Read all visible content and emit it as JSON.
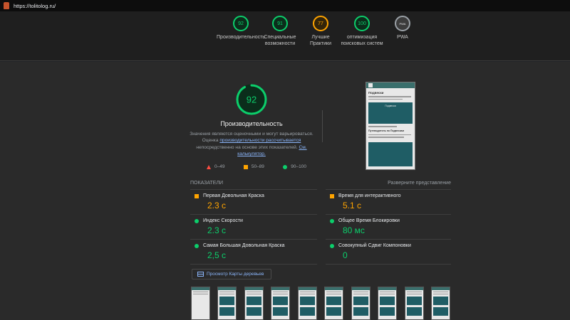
{
  "browser": {
    "url": "https://tolitolog.ru/"
  },
  "categories": [
    {
      "score": "92",
      "label": "Производительность",
      "color": "green"
    },
    {
      "score": "91",
      "label": "Специальные возможности",
      "color": "green"
    },
    {
      "score": "77",
      "label": "Лучшие Практики",
      "color": "orange"
    },
    {
      "score": "100",
      "label": "оптимизация поисковых систем",
      "color": "green"
    },
    {
      "score": "PWA",
      "label": "PWA",
      "color": "gray"
    }
  ],
  "performance": {
    "score": 92,
    "score_text": "92",
    "title": "Производительность",
    "desc_1": "Значения являются оценочными и могут варьироваться. Оценка ",
    "desc_link_1": "производительности рассчитывается",
    "desc_2": " непосредственно на основе этих показателей. ",
    "desc_link_2": "См. калькулятор.",
    "legend": {
      "fail": "0–49",
      "average": "50–89",
      "pass": "90–100"
    }
  },
  "screenshot": {
    "title": "Подвески",
    "card_title": "Подвески",
    "subheading": "Путеводитель по Подвескам"
  },
  "metrics": {
    "header": "ПОКАЗАТЕЛИ",
    "expand": "Разверните представление",
    "items": [
      {
        "label": "Первая Довольная Краска",
        "value": "2.3 с",
        "status": "average"
      },
      {
        "label": "Время для интерактивного",
        "value": "5.1 с",
        "status": "average"
      },
      {
        "label": "Индекс Скорости",
        "value": "2.3 с",
        "status": "pass"
      },
      {
        "label": "Общее Время Блокировки",
        "value": "80 мс",
        "status": "pass"
      },
      {
        "label": "Самая Большая Довольная Краска",
        "value": "2,5 с",
        "status": "pass"
      },
      {
        "label": "Совокупный Сдвиг Компоновки",
        "value": "0",
        "status": "pass"
      }
    ]
  },
  "treemap_button": "Просмотр Карты деревьев",
  "colors": {
    "pass": "#0cce6b",
    "average": "#ffa400",
    "fail": "#ff4e42",
    "background": "#202124"
  }
}
